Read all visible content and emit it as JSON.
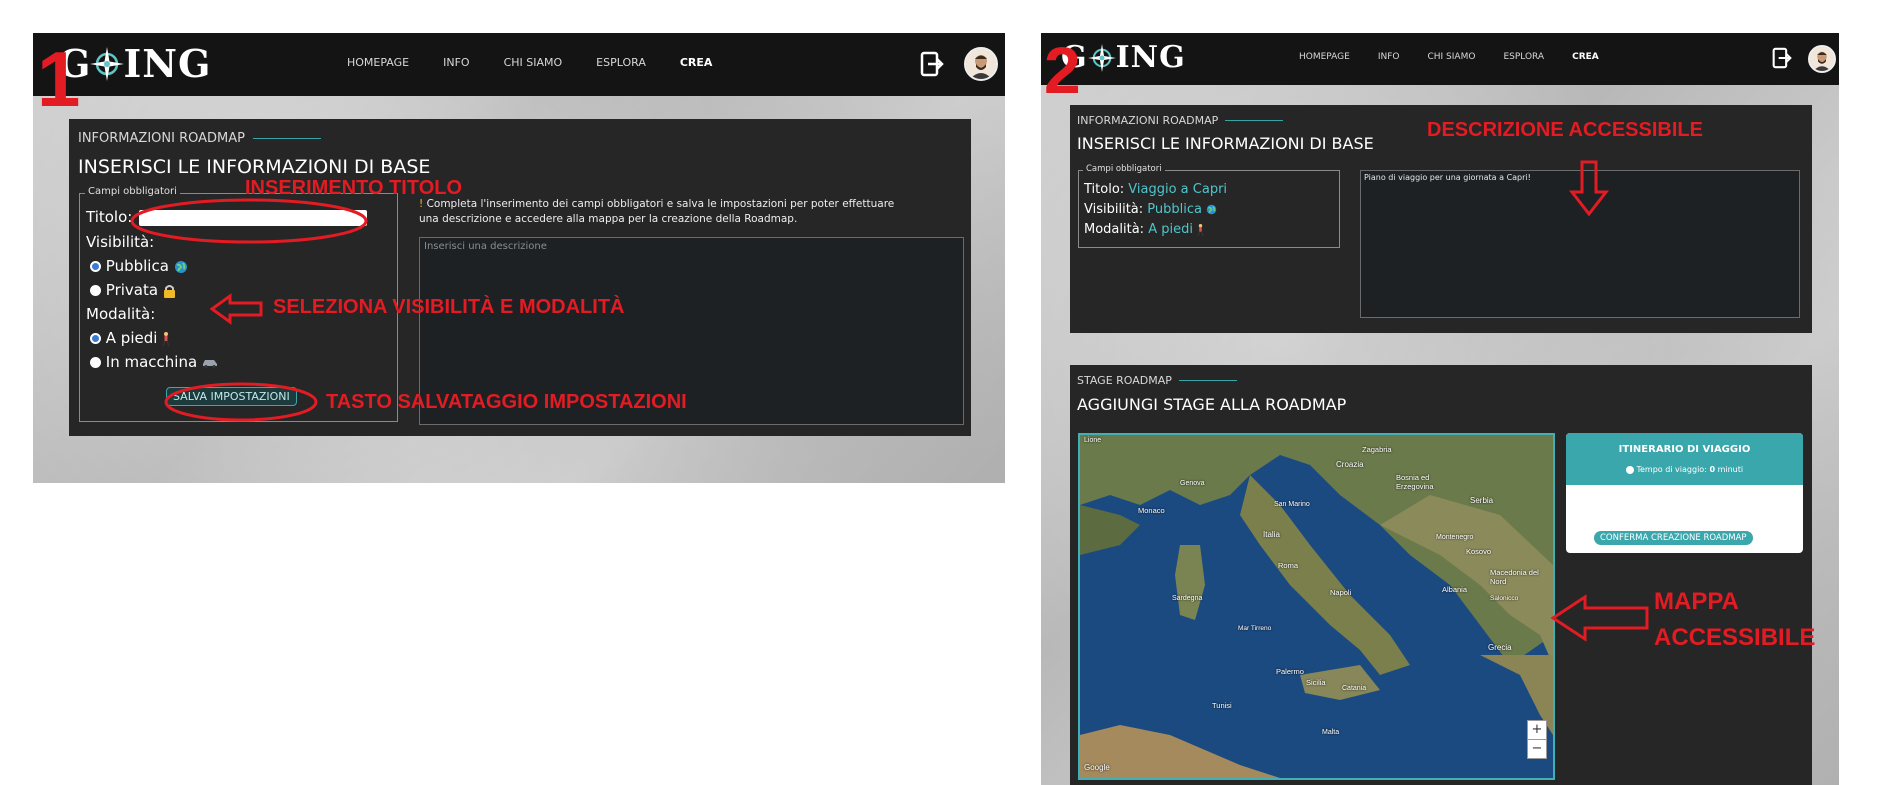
{
  "screen1": {
    "number": "1",
    "logo": "G⌖ING",
    "logo_left": "G",
    "logo_right": "ING",
    "nav": [
      "HOMEPAGE",
      "INFO",
      "CHI SIAMO",
      "ESPLORA",
      "CREA"
    ],
    "active_nav": "CREA",
    "section_label": "INFORMAZIONI ROADMAP",
    "section_title": "INSERISCI LE INFORMAZIONI DI BASE",
    "fieldset_legend": "Campi obbligatori",
    "title_label": "Titolo:",
    "title_value": "",
    "visibility_label": "Visibilità:",
    "visibility_options": [
      "Pubblica",
      "Privata"
    ],
    "mode_label": "Modalità:",
    "mode_options": [
      "A piedi",
      "In macchina"
    ],
    "save_button": "SALVA IMPOSTAZIONI",
    "notice": "Completa l'inserimento dei campi obbligatori e salva le impostazioni per poter effettuare una descrizione e accedere alla mappa per la creazione della Roadmap.",
    "description_placeholder": "Inserisci una descrizione",
    "annotations": {
      "title": "INSERIMENTO TITOLO",
      "visibility": "SELEZIONA VISIBILITÀ E MODALITÀ",
      "save": "TASTO SALVATAGGIO IMPOSTAZIONI"
    }
  },
  "screen2": {
    "number": "2",
    "logo_left": "G",
    "logo_right": "ING",
    "nav": [
      "HOMEPAGE",
      "INFO",
      "CHI SIAMO",
      "ESPLORA",
      "CREA"
    ],
    "active_nav": "CREA",
    "section_label": "INFORMAZIONI ROADMAP",
    "section_title": "INSERISCI LE INFORMAZIONI DI BASE",
    "fieldset_legend": "Campi obbligatori",
    "title_label": "Titolo:",
    "title_value": "Viaggio a Capri",
    "visibility_label": "Visibilità:",
    "visibility_value": "Pubblica",
    "mode_label": "Modalità:",
    "mode_value": "A piedi",
    "description_value": "Piano di viaggio per una giornata a Capri!",
    "stage_label": "STAGE ROADMAP",
    "stage_title": "AGGIUNGI STAGE ALLA ROADMAP",
    "itinerary_title": "ITINERARIO DI VIAGGIO",
    "travel_time_label": "Tempo di viaggio:",
    "travel_time_value": "0",
    "travel_time_unit": "minuti",
    "confirm_button": "CONFERMA CREAZIONE ROADMAP",
    "zoom_in": "+",
    "zoom_out": "−",
    "map_labels": [
      "Lione",
      "Genova",
      "Monaco",
      "Croazia",
      "Zagabria",
      "Bosnia ed Erzegovina",
      "Serbia",
      "Italia",
      "San Marino",
      "Montenegro",
      "Kosovo",
      "Roma",
      "Albania",
      "Macedonia del Nord",
      "Napoli",
      "Sardegna",
      "Mar Tirreno",
      "Palermo",
      "Sicilia",
      "Catania",
      "Malta",
      "Tunisi",
      "Grecia",
      "Salonicco"
    ],
    "google": "Google",
    "annotations": {
      "description": "DESCRIZIONE ACCESSIBILE",
      "map_line1": "MAPPA",
      "map_line2": "ACCESSIBILE"
    }
  },
  "colors": {
    "annotation_red": "#e31b23",
    "teal": "#3aa7ad",
    "panel": "#262626",
    "topbar": "#141414"
  }
}
